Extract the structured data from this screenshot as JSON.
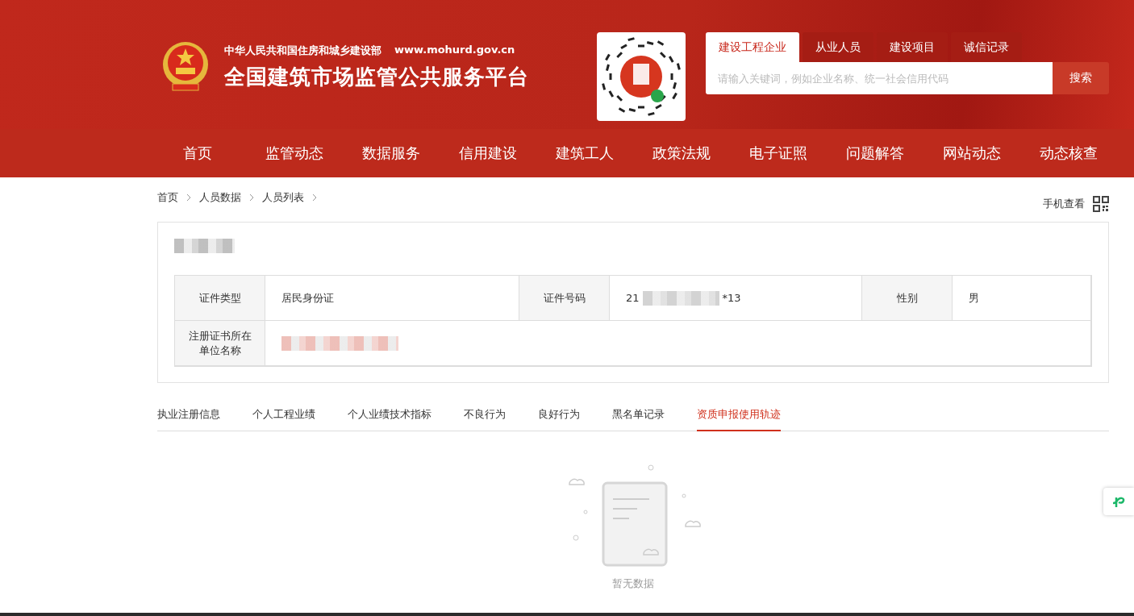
{
  "header": {
    "ministry": "中华人民共和国住房和城乡建设部",
    "url": "www.mohurd.gov.cn",
    "title": "全国建筑市场监管公共服务平台"
  },
  "search": {
    "tabs": [
      {
        "label": "建设工程企业",
        "selected": true
      },
      {
        "label": "从业人员",
        "selected": false
      },
      {
        "label": "建设项目",
        "selected": false
      },
      {
        "label": "诚信记录",
        "selected": false
      }
    ],
    "placeholder": "请输入关键词，例如企业名称、统一社会信用代码",
    "button": "搜索"
  },
  "nav": [
    "首页",
    "监管动态",
    "数据服务",
    "信用建设",
    "建筑工人",
    "政策法规",
    "电子证照",
    "问题解答",
    "网站动态",
    "动态核查"
  ],
  "breadcrumb": [
    "首页",
    "人员数据",
    "人员列表"
  ],
  "mobile_view": "手机查看",
  "info_rows": [
    [
      {
        "label": "证件类型",
        "kind": "text",
        "value": "居民身份证"
      },
      {
        "label": "证件号码",
        "kind": "masked",
        "start": "21",
        "end": "*13"
      },
      {
        "label": "性别",
        "kind": "text",
        "value": "男"
      }
    ],
    [
      {
        "label": "注册证书所在单位名称",
        "kind": "redacted"
      }
    ]
  ],
  "tabs": [
    {
      "label": "执业注册信息",
      "selected": false
    },
    {
      "label": "个人工程业绩",
      "selected": false
    },
    {
      "label": "个人业绩技术指标",
      "selected": false
    },
    {
      "label": "不良行为",
      "selected": false
    },
    {
      "label": "良好行为",
      "selected": false
    },
    {
      "label": "黑名单记录",
      "selected": false
    },
    {
      "label": "资质申报使用轨迹",
      "selected": true
    }
  ],
  "empty_text": "暂无数据"
}
